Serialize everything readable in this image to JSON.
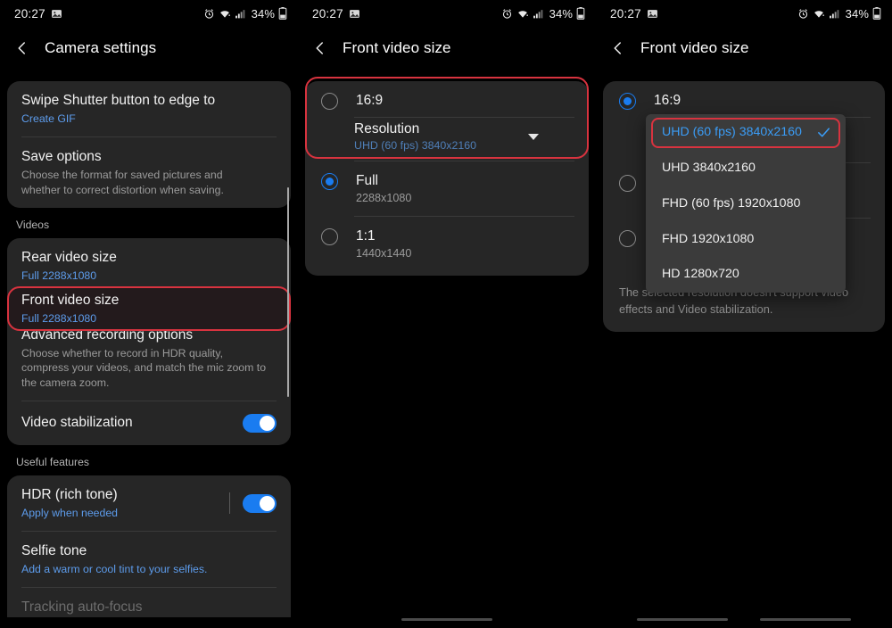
{
  "status_bar": {
    "time": "20:27",
    "battery_percent": "34%",
    "icons": [
      "gallery-icon",
      "alarm-icon",
      "wifi-icon",
      "signal-icon",
      "battery-icon"
    ]
  },
  "screen1": {
    "title": "Camera settings",
    "back_icon": "back-chevron-icon",
    "card1": {
      "items": [
        {
          "title": "Swipe Shutter button to edge to",
          "sub": "Create GIF",
          "sub_style": "blue"
        },
        {
          "title": "Save options",
          "sub": "Choose the format for saved pictures and whether to correct distortion when saving.",
          "sub_style": "grey"
        }
      ]
    },
    "section_videos": "Videos",
    "card2": {
      "items": [
        {
          "title": "Rear video size",
          "sub": "Full 2288x1080",
          "sub_style": "blue",
          "highlighted": false
        },
        {
          "title": "Front video size",
          "sub": "Full 2288x1080",
          "sub_style": "blue",
          "highlighted": true
        },
        {
          "title": "Advanced recording options",
          "sub": "Choose whether to record in HDR quality, compress your videos, and match the mic zoom to the camera zoom.",
          "sub_style": "grey",
          "highlighted": false
        }
      ],
      "toggle_row": {
        "title": "Video stabilization",
        "toggle_on": true
      }
    },
    "section_useful": "Useful features",
    "card3": {
      "items": [
        {
          "title": "HDR (rich tone)",
          "sub": "Apply when needed",
          "sub_style": "blue",
          "toggle_on": true,
          "divider_before_toggle": true
        },
        {
          "title": "Selfie tone",
          "sub": "Add a warm or cool tint to your selfies.",
          "sub_style": "blue"
        },
        {
          "title": "Tracking auto-focus",
          "sub": "",
          "sub_style": "grey"
        }
      ]
    }
  },
  "screen2": {
    "title": "Front video size",
    "back_icon": "back-chevron-icon",
    "options": [
      {
        "label": "16:9",
        "sub": "",
        "selected": false,
        "highlighted": true,
        "resolution": {
          "label": "Resolution",
          "value": "UHD (60 fps) 3840x2160",
          "caret_icon": "chevron-down-icon"
        }
      },
      {
        "label": "Full",
        "sub": "2288x1080",
        "selected": true,
        "highlighted": false
      },
      {
        "label": "1:1",
        "sub": "1440x1440",
        "selected": false,
        "highlighted": false
      }
    ]
  },
  "screen3": {
    "title": "Front video size",
    "back_icon": "back-chevron-icon",
    "options": [
      {
        "label": "16:9",
        "sub": "",
        "selected": true
      },
      {
        "label": "",
        "sub": "",
        "selected": false
      },
      {
        "label": "",
        "sub": "",
        "selected": false
      }
    ],
    "note": "The selected resolution doesn't support video effects and Video stabilization.",
    "dropdown": {
      "selected_index": 0,
      "check_icon": "check-icon",
      "items": [
        "UHD (60 fps) 3840x2160",
        "UHD 3840x2160",
        "FHD (60 fps) 1920x1080",
        "FHD 1920x1080",
        "HD 1280x720"
      ]
    }
  },
  "colors": {
    "accent_blue": "#1a7cf0",
    "link_blue": "#5d9cec",
    "highlight_red": "#d8333f",
    "card_bg": "#262626",
    "page_bg": "#000000"
  }
}
